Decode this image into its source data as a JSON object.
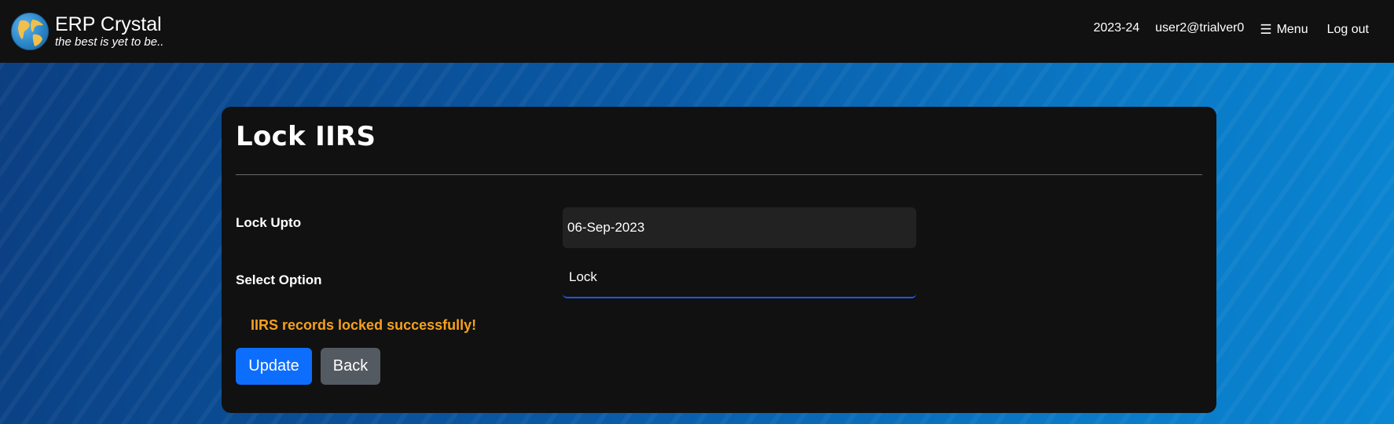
{
  "brand": {
    "title": "ERP Crystal",
    "tagline": "the best is yet to be.."
  },
  "nav": {
    "year": "2023-24",
    "user": "user2@trialver0",
    "menu_label": "Menu",
    "logout_label": "Log out"
  },
  "form": {
    "title": "Lock IIRS",
    "lock_upto_label": "Lock Upto",
    "lock_upto_value": "06-Sep-2023",
    "select_option_label": "Select Option",
    "select_option_value": "Lock",
    "message": "IIRS records locked successfully!",
    "update_label": "Update",
    "back_label": "Back"
  },
  "colors": {
    "accent": "#0d6efd",
    "message": "#f5a11e",
    "topbar": "#111111"
  }
}
